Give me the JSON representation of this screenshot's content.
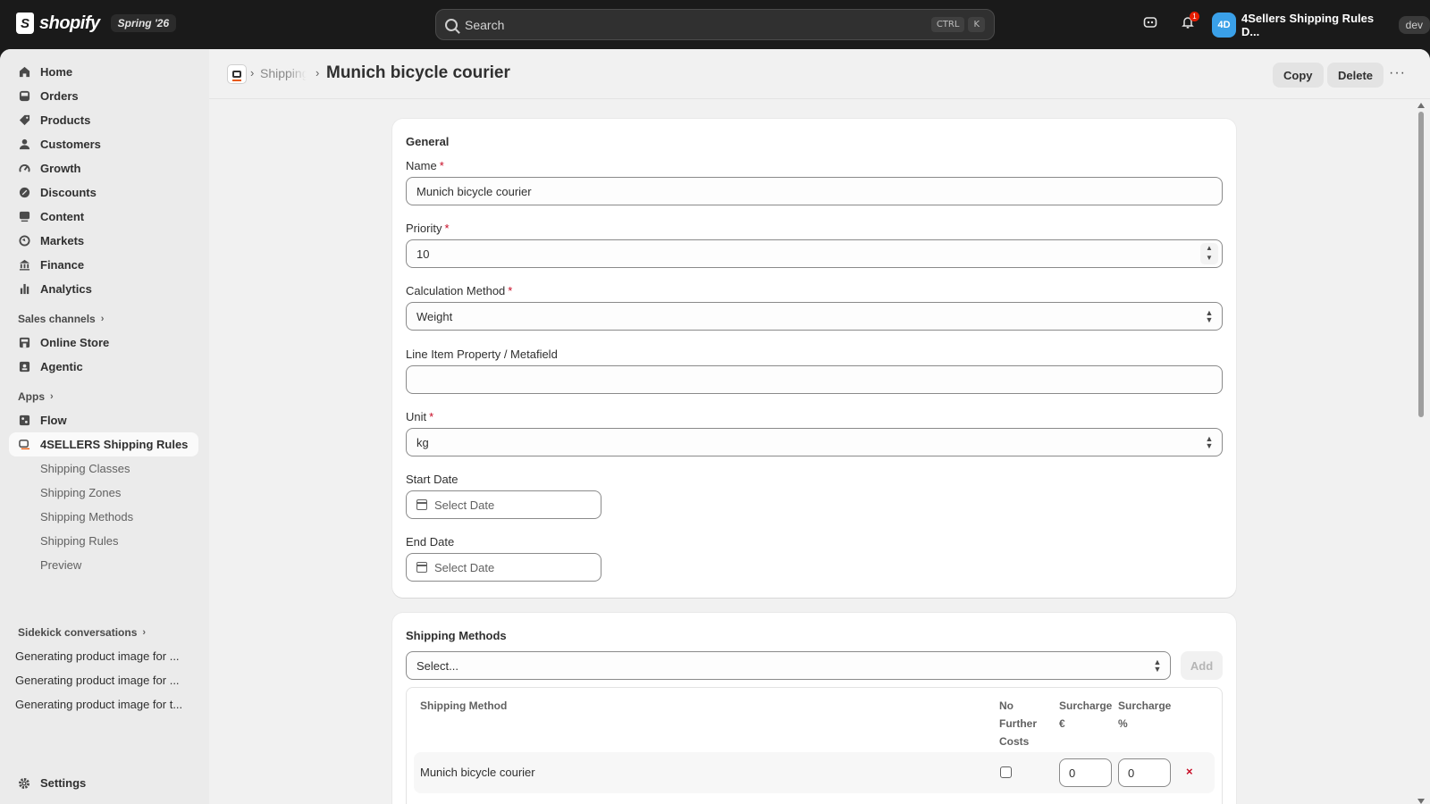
{
  "topbar": {
    "brand": "shopify",
    "edition_badge": "Spring '26",
    "search_placeholder": "Search",
    "shortcut_key1": "CTRL",
    "shortcut_key2": "K",
    "notification_count": "1",
    "store_initials": "4D",
    "store_name": "4Sellers Shipping Rules D...",
    "env_badge": "dev"
  },
  "sidebar": {
    "items": [
      {
        "label": "Home",
        "icon": "home-icon"
      },
      {
        "label": "Orders",
        "icon": "inbox-icon"
      },
      {
        "label": "Products",
        "icon": "tag-icon"
      },
      {
        "label": "Customers",
        "icon": "person-icon"
      },
      {
        "label": "Growth",
        "icon": "gauge-icon"
      },
      {
        "label": "Discounts",
        "icon": "discount-icon"
      },
      {
        "label": "Content",
        "icon": "content-icon"
      },
      {
        "label": "Markets",
        "icon": "globe-icon"
      },
      {
        "label": "Finance",
        "icon": "bank-icon"
      },
      {
        "label": "Analytics",
        "icon": "bar-chart-icon"
      }
    ],
    "sales_channels_label": "Sales channels",
    "channels": [
      {
        "label": "Online Store",
        "icon": "store-icon"
      },
      {
        "label": "Agentic",
        "icon": "agent-icon"
      }
    ],
    "apps_label": "Apps",
    "apps": [
      {
        "label": "Flow",
        "icon": "flow-icon"
      },
      {
        "label": "4SELLERS Shipping Rules",
        "icon": "app-icon"
      }
    ],
    "app_subitems": [
      "Shipping Classes",
      "Shipping Zones",
      "Shipping Methods",
      "Shipping Rules",
      "Preview"
    ],
    "sidekick_label": "Sidekick conversations",
    "conversations": [
      "Generating product image for ...",
      "Generating product image for ...",
      "Generating product image for t..."
    ],
    "settings_label": "Settings"
  },
  "header": {
    "breadcrumb_link": "Shipping Rules",
    "title": "Munich bicycle courier",
    "copy_label": "Copy",
    "delete_label": "Delete",
    "more_label": "···"
  },
  "general": {
    "title": "General",
    "name_label": "Name",
    "name_value": "Munich bicycle courier",
    "priority_label": "Priority",
    "priority_value": "10",
    "calc_label": "Calculation Method",
    "calc_value": "Weight",
    "line_item_label": "Line Item Property / Metafield",
    "line_item_value": "",
    "unit_label": "Unit",
    "unit_value": "kg",
    "start_label": "Start Date",
    "start_placeholder": "Select Date",
    "end_label": "End Date",
    "end_placeholder": "Select Date",
    "required_mark": "*"
  },
  "shipping_methods": {
    "title": "Shipping Methods",
    "select_placeholder": "Select...",
    "add_label": "Add",
    "col_method": "Shipping Method",
    "col_no_further_l1": "No",
    "col_no_further_l2": "Further",
    "col_no_further_l3": "Costs",
    "col_surcharge_eur_l1": "Surcharge",
    "col_surcharge_eur_l2": "€",
    "col_surcharge_pct_l1": "Surcharge",
    "col_surcharge_pct_l2": "%",
    "rows": [
      {
        "method": "Munich bicycle courier",
        "no_further_costs": false,
        "surcharge_eur": "0",
        "surcharge_pct": "0",
        "remove": "×"
      }
    ]
  },
  "colors": {
    "topbar_bg": "#1a1a1a",
    "page_bg": "#f1f1f1",
    "required": "#c70a24",
    "store_avatar": "#3aa0e8"
  }
}
